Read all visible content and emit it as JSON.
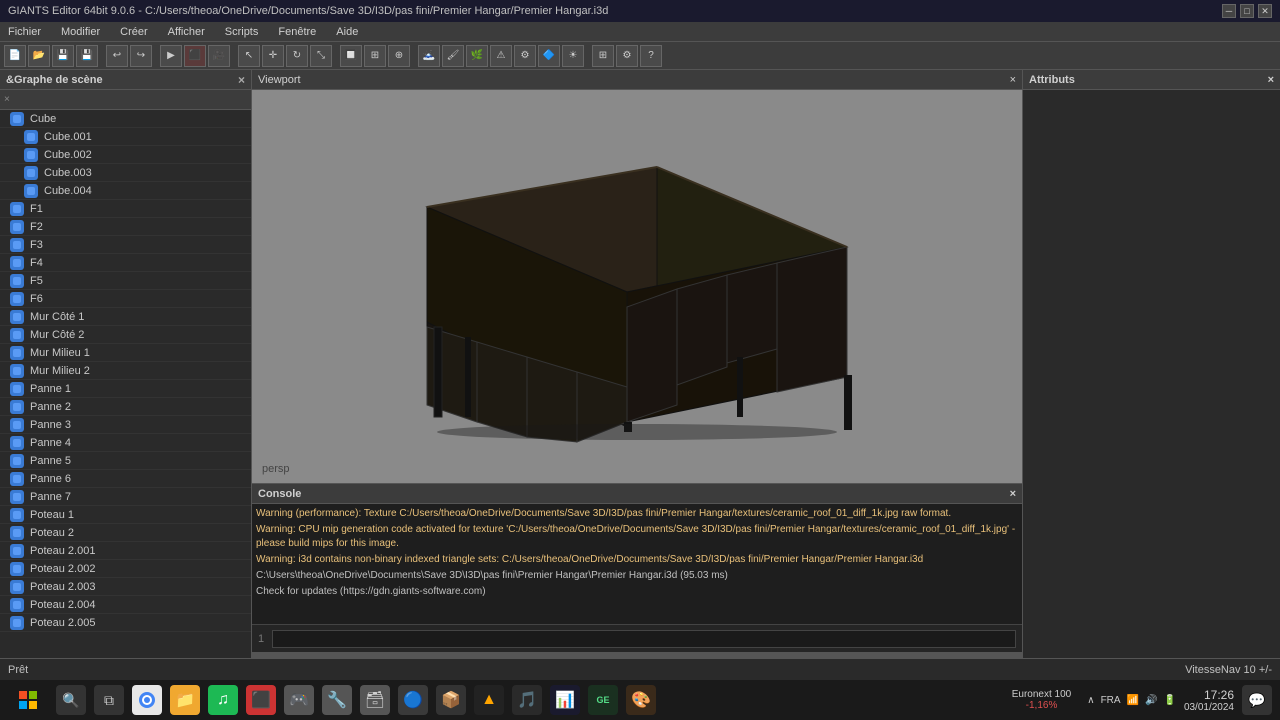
{
  "titleBar": {
    "title": "GIANTS Editor 64bit 9.0.6 - C:/Users/theoa/OneDrive/Documents/Save 3D/I3D/pas fini/Premier Hangar/Premier Hangar.i3d"
  },
  "menuBar": {
    "items": [
      "Fichier",
      "Modifier",
      "Créer",
      "Afficher",
      "Scripts",
      "Fenêtre",
      "Aide"
    ]
  },
  "sceneGraph": {
    "title": "&Graphe de scène",
    "closeBtn": "×",
    "searchPlaceholder": "×",
    "items": [
      {
        "label": "Cube",
        "level": 0
      },
      {
        "label": "Cube.001",
        "level": 1
      },
      {
        "label": "Cube.002",
        "level": 1
      },
      {
        "label": "Cube.003",
        "level": 1
      },
      {
        "label": "Cube.004",
        "level": 1
      },
      {
        "label": "F1",
        "level": 0
      },
      {
        "label": "F2",
        "level": 0
      },
      {
        "label": "F3",
        "level": 0
      },
      {
        "label": "F4",
        "level": 0
      },
      {
        "label": "F5",
        "level": 0
      },
      {
        "label": "F6",
        "level": 0
      },
      {
        "label": "Mur Côté 1",
        "level": 0
      },
      {
        "label": "Mur Côté 2",
        "level": 0
      },
      {
        "label": "Mur Milieu 1",
        "level": 0
      },
      {
        "label": "Mur Milieu 2",
        "level": 0
      },
      {
        "label": "Panne 1",
        "level": 0
      },
      {
        "label": "Panne 2",
        "level": 0
      },
      {
        "label": "Panne 3",
        "level": 0
      },
      {
        "label": "Panne 4",
        "level": 0
      },
      {
        "label": "Panne 5",
        "level": 0
      },
      {
        "label": "Panne 6",
        "level": 0
      },
      {
        "label": "Panne 7",
        "level": 0
      },
      {
        "label": "Poteau 1",
        "level": 0
      },
      {
        "label": "Poteau 2",
        "level": 0
      },
      {
        "label": "Poteau 2.001",
        "level": 0
      },
      {
        "label": "Poteau 2.002",
        "level": 0
      },
      {
        "label": "Poteau 2.003",
        "level": 0
      },
      {
        "label": "Poteau 2.004",
        "level": 0
      },
      {
        "label": "Poteau 2.005",
        "level": 0
      }
    ]
  },
  "viewport": {
    "title": "Viewport",
    "closeBtn": "×",
    "perspLabel": "persp"
  },
  "attributes": {
    "title": "Attributs",
    "closeBtn": "×"
  },
  "console": {
    "title": "Console",
    "closeBtn": "×",
    "messages": [
      {
        "text": "Warning (performance): Texture C:/Users/theoa/OneDrive/Documents/Save 3D/I3D/pas fini/Premier Hangar/textures/ceramic_roof_01_diff_1k.jpg raw format.",
        "type": "warning"
      },
      {
        "text": "Warning: CPU mip generation code activated for texture 'C:/Users/theoa/OneDrive/Documents/Save 3D/I3D/pas fini/Premier Hangar/textures/ceramic_roof_01_diff_1k.jpg' - please build mips for this image.",
        "type": "warning"
      },
      {
        "text": "Warning: i3d contains non-binary indexed triangle sets: C:/Users/theoa/OneDrive/Documents/Save 3D/I3D/pas fini/Premier Hangar/Premier Hangar.i3d",
        "type": "warning"
      },
      {
        "text": "C:\\Users\\theoa\\OneDrive\\Documents\\Save 3D\\I3D\\pas fini\\Premier Hangar\\Premier Hangar.i3d (95.03 ms)",
        "type": "normal"
      },
      {
        "text": "Check for updates (https://gdn.giants-software.com)",
        "type": "normal"
      }
    ],
    "inputValue": "1"
  },
  "statusBar": {
    "leftText": "Prêt",
    "rightText": "VitesseNav 10 +/-"
  },
  "taskbar": {
    "stockName": "Euronext 100",
    "stockChange": "-1,16%",
    "time": "17:26",
    "date": "03/01/2024",
    "language": "FRA"
  }
}
